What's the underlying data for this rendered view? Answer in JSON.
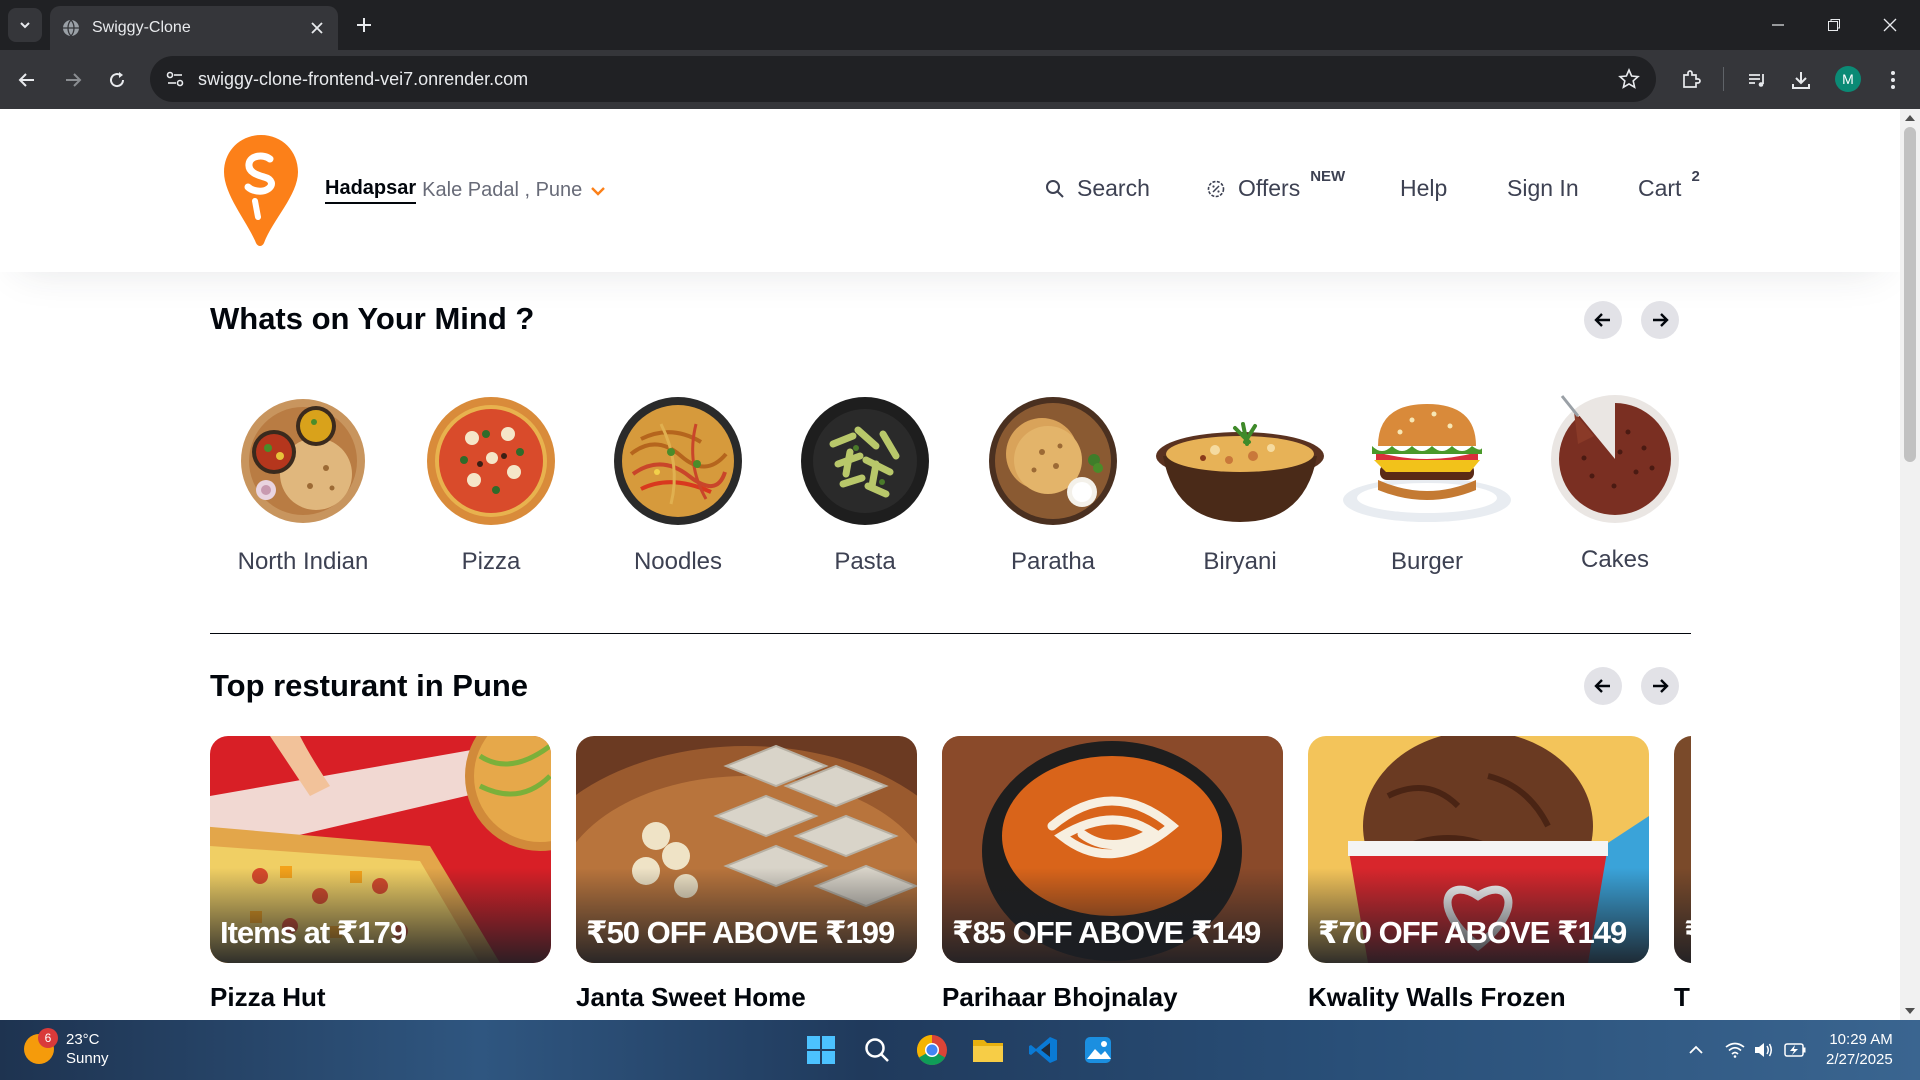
{
  "browser": {
    "tab_title": "Swiggy-Clone",
    "url": "swiggy-clone-frontend-vei7.onrender.com",
    "profile_initial": "M"
  },
  "header": {
    "location_main": "Hadapsar",
    "location_sub": "Kale Padal , Pune",
    "nav": {
      "search": "Search",
      "offers": "Offers",
      "offers_badge": "NEW",
      "help": "Help",
      "signin": "Sign In",
      "cart": "Cart",
      "cart_count": "2"
    },
    "brand_color": "#fc8019"
  },
  "whats_on_mind": {
    "title": "Whats on Your Mind ?",
    "categories": [
      {
        "label": "North Indian"
      },
      {
        "label": "Pizza"
      },
      {
        "label": "Noodles"
      },
      {
        "label": "Pasta"
      },
      {
        "label": "Paratha"
      },
      {
        "label": "Biryani"
      },
      {
        "label": "Burger"
      },
      {
        "label": "Cakes"
      }
    ]
  },
  "top_restaurants": {
    "title": "Top resturant in Pune",
    "cards": [
      {
        "offer": "Items at ₹179",
        "name": "Pizza Hut"
      },
      {
        "offer": "₹50 OFF ABOVE ₹199",
        "name": "Janta Sweet Home"
      },
      {
        "offer": "₹85 OFF ABOVE ₹149",
        "name": "Parihaar Bhojnalay"
      },
      {
        "offer": "₹70 OFF ABOVE ₹149",
        "name": "Kwality Walls Frozen"
      },
      {
        "offer": "₹",
        "name": "T"
      }
    ]
  },
  "taskbar": {
    "weather_temp": "23°C",
    "weather_desc": "Sunny",
    "weather_badge": "6",
    "time": "10:29 AM",
    "date": "2/27/2025"
  }
}
